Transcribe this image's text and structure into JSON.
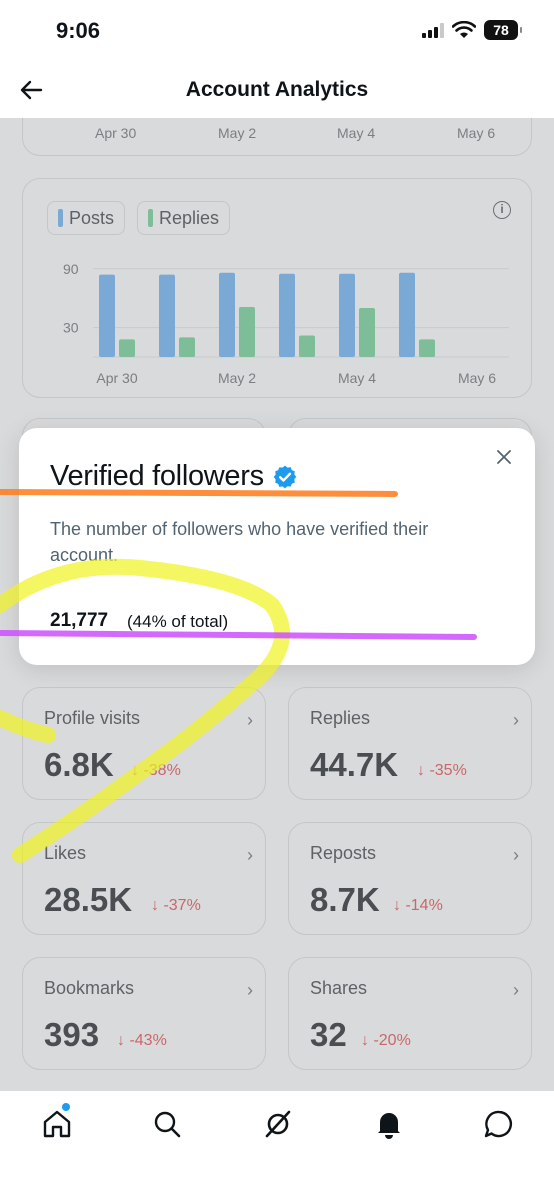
{
  "status_bar": {
    "time": "9:06",
    "battery": "78"
  },
  "header": {
    "title": "Account Analytics"
  },
  "top_chart_axis": [
    "Apr 30",
    "May 2",
    "May 4",
    "May 6"
  ],
  "chart_data": {
    "type": "bar",
    "categories": [
      "Apr 30",
      "May 1",
      "May 2",
      "May 3",
      "May 4",
      "May 5"
    ],
    "x_tick_labels": [
      "Apr 30",
      "May 2",
      "May 4",
      "May 6"
    ],
    "y_tick_labels": [
      "90",
      "30"
    ],
    "series": [
      {
        "name": "Posts",
        "color": "#4a90d9",
        "values": [
          84,
          84,
          86,
          85,
          85,
          86
        ]
      },
      {
        "name": "Replies",
        "color": "#44b07a",
        "values": [
          18,
          20,
          51,
          22,
          50,
          18
        ]
      }
    ],
    "ylim": [
      0,
      100
    ],
    "legend": "top-left",
    "grid": true
  },
  "popover": {
    "title": "Verified followers",
    "description": "The number of followers who have verified their account.",
    "count": "21,777",
    "percent": "(44% of total)"
  },
  "stats": [
    {
      "label": "Profile visits",
      "value": "6.8K",
      "change": "↓ -38%"
    },
    {
      "label": "Replies",
      "value": "44.7K",
      "change": "↓ -35%"
    },
    {
      "label": "Likes",
      "value": "28.5K",
      "change": "↓ -37%"
    },
    {
      "label": "Reposts",
      "value": "8.7K",
      "change": "↓ -14%"
    },
    {
      "label": "Bookmarks",
      "value": "393",
      "change": "↓ -43%"
    },
    {
      "label": "Shares",
      "value": "32",
      "change": "↓ -20%"
    }
  ],
  "tabs": [
    "home-icon",
    "search-icon",
    "grok-icon",
    "notifications-icon",
    "messages-icon"
  ],
  "colors": {
    "accent": "#1d9bf0",
    "negative": "#c9676a",
    "highlight_yellow": "#f0f21f",
    "underline_orange": "#ff7a1a",
    "underline_purple": "#cc4fff"
  }
}
